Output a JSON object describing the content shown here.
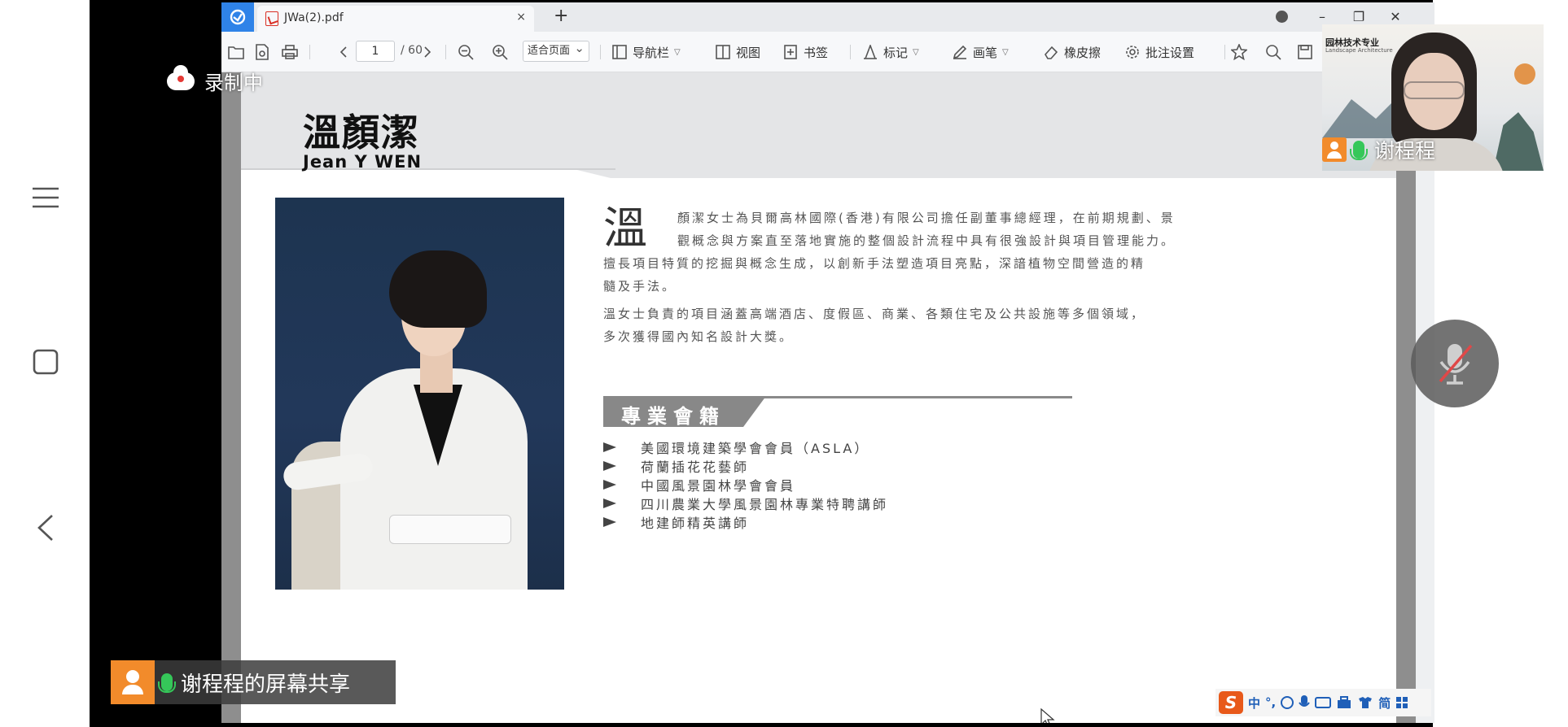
{
  "recording": {
    "label": "录制中"
  },
  "pdf_app": {
    "tab_title": "JWa(2).pdf",
    "tab_close": "×",
    "new_tab": "+",
    "window_controls": {
      "minimize": "–",
      "restore": "❐",
      "close": "✕"
    }
  },
  "toolbar": {
    "page_current": "1",
    "page_total": "/ 60",
    "zoom_mode": "适合页面",
    "nav_pane": "导航栏",
    "view": "视图",
    "bookmark": "书签",
    "mark": "标记",
    "pen": "画笔",
    "eraser": "橡皮擦",
    "annotation_settings": "批注设置"
  },
  "document": {
    "name_cn": "溫顏潔",
    "name_en": "Jean Y WEN",
    "bio_dropcap": "溫",
    "bio_lines": [
      "顏潔女士為貝爾高林國際(香港)有限公司擔任副董事總經理，在前期規劃、景",
      "觀概念與方案直至落地實施的整個設計流程中具有很強設計與項目管理能力。",
      "擅長項目特質的挖掘與概念生成，以創新手法塑造項目亮點，深諳植物空間營造的精",
      "髓及手法。",
      "溫女士負責的項目涵蓋高端酒店、度假區、商業、各類住宅及公共設施等多個領域，",
      "多次獲得國內知名設計大獎。"
    ],
    "section_title": "專業會籍",
    "memberships": [
      "美國環境建築學會會員（ASLA）",
      "荷蘭插花花藝師",
      "中國風景園林學會會員",
      "四川農業大學風景園林專業特聘講師",
      "地建師精英講師"
    ]
  },
  "ime": {
    "logo": "S",
    "items": [
      "中",
      "°,",
      "简"
    ]
  },
  "video": {
    "logo_text": "园林技术专业",
    "logo_sub": "Landscape Architecture",
    "presenter_name": "谢程程"
  },
  "share": {
    "label": "谢程程的屏幕共享"
  },
  "colors": {
    "accent_blue": "#2f83e8",
    "badge_orange": "#f28b2b",
    "mic_green": "#35c759"
  }
}
